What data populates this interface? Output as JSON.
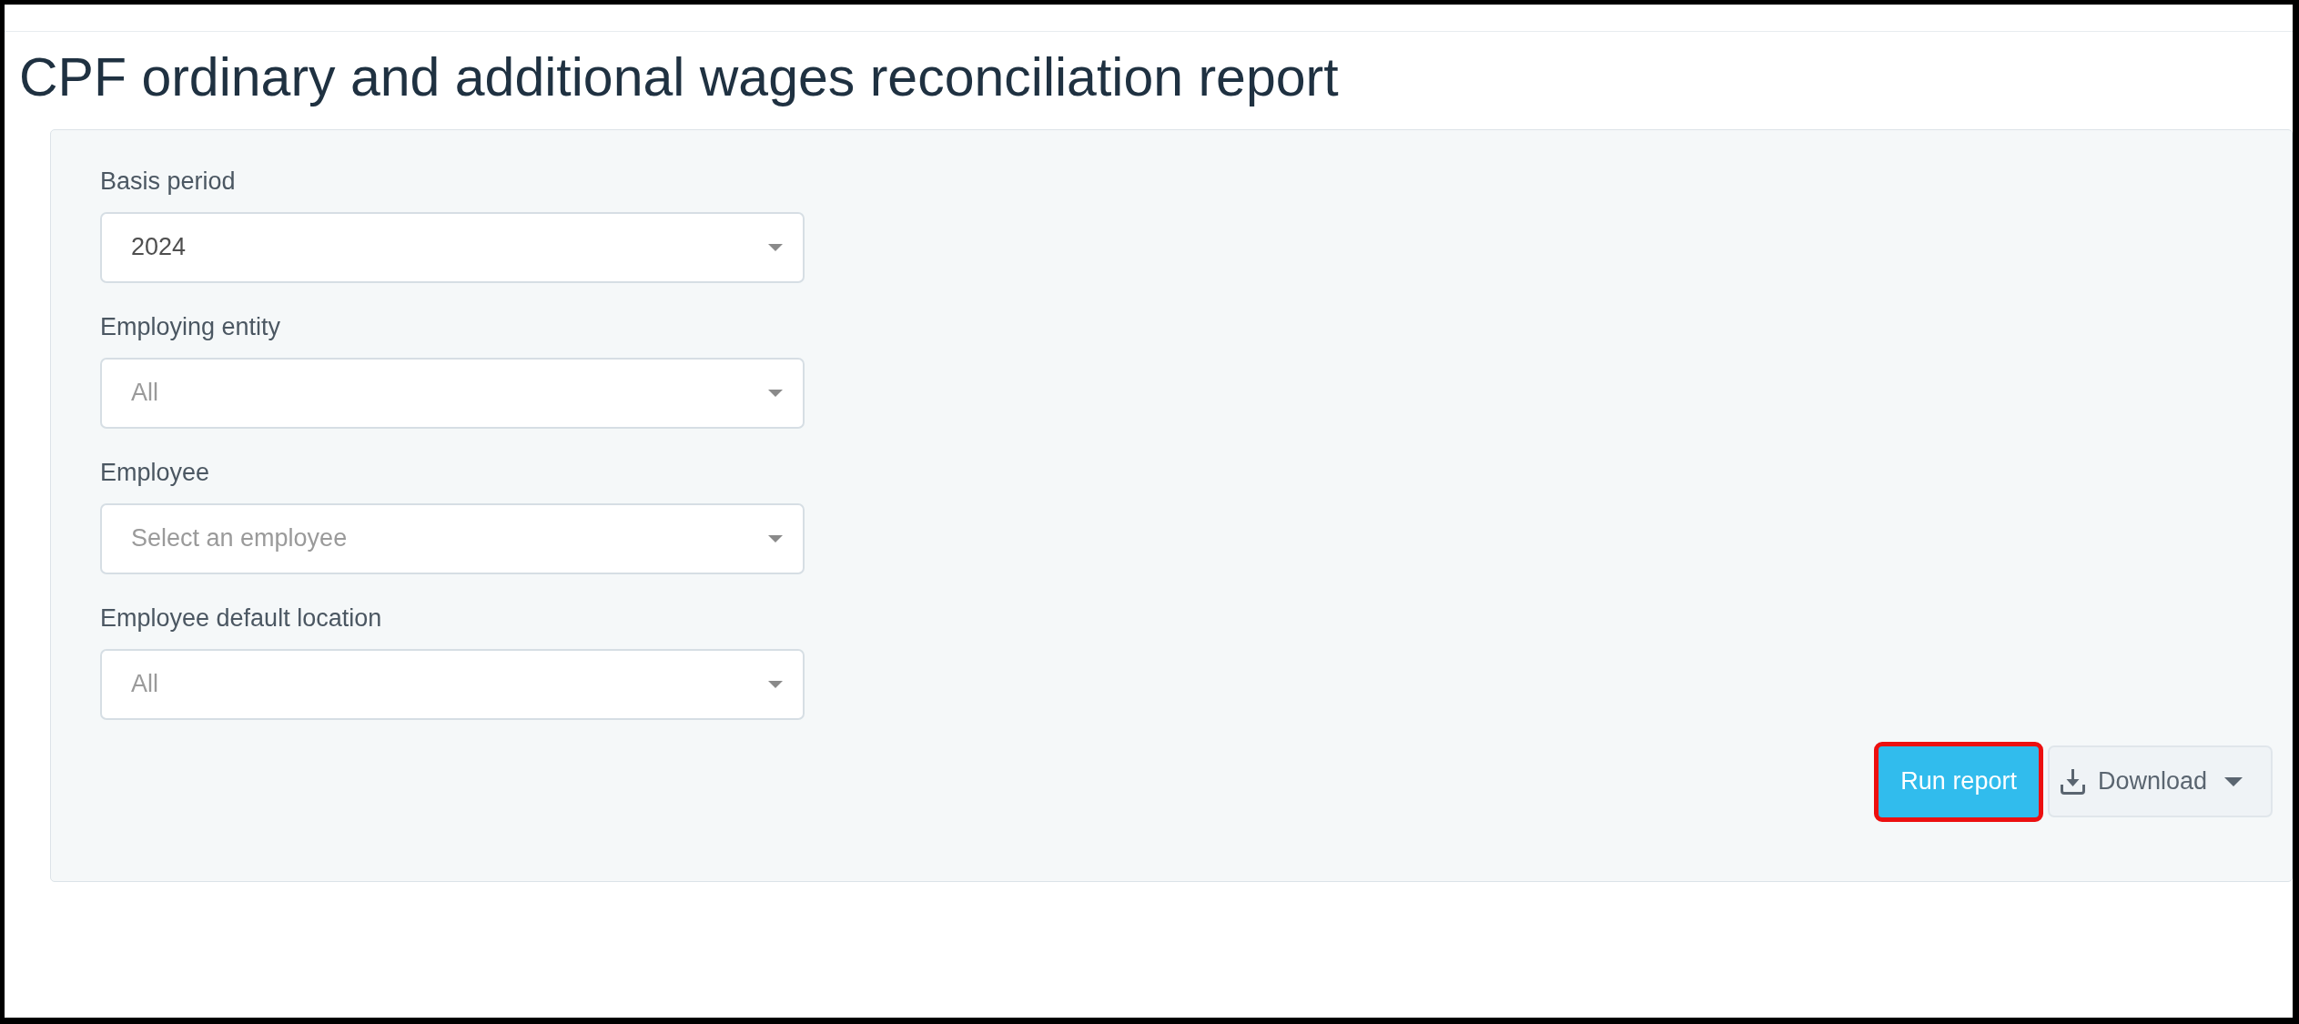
{
  "title": "CPF ordinary and additional wages reconciliation report",
  "filters": [
    {
      "label": "Basis period",
      "value": "2024"
    },
    {
      "label": "Employing entity",
      "placeholder": "All"
    },
    {
      "label": "Employee",
      "placeholder": "Select an employee"
    },
    {
      "label": "Employee default location",
      "placeholder": "All"
    }
  ],
  "actions": [
    {
      "kind": "primary",
      "label": "Run report",
      "highlighted": true
    },
    {
      "kind": "dropdown",
      "label": "Download"
    }
  ]
}
